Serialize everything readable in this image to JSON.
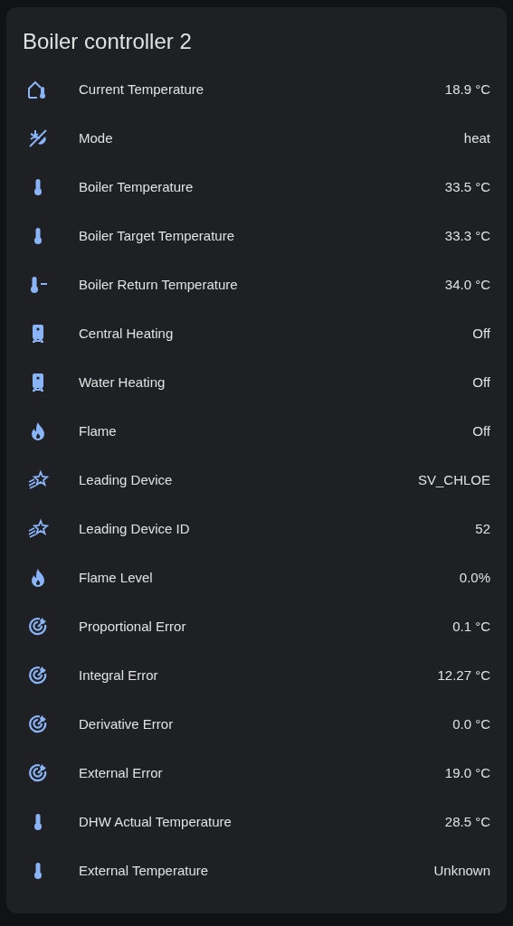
{
  "card": {
    "title": "Boiler controller 2",
    "rows": [
      {
        "kind": "house",
        "name": "Current Temperature",
        "value": "18.9 °C"
      },
      {
        "kind": "mode",
        "name": "Mode",
        "value": "heat"
      },
      {
        "kind": "thermometer",
        "name": "Boiler Temperature",
        "value": "33.5 °C"
      },
      {
        "kind": "thermometer",
        "name": "Boiler Target Temperature",
        "value": "33.3 °C"
      },
      {
        "kind": "return",
        "name": "Boiler Return Temperature",
        "value": "34.0 °C"
      },
      {
        "kind": "boiler",
        "name": "Central Heating",
        "value": "Off"
      },
      {
        "kind": "boiler",
        "name": "Water Heating",
        "value": "Off"
      },
      {
        "kind": "flame",
        "name": "Flame",
        "value": "Off"
      },
      {
        "kind": "star",
        "name": "Leading Device",
        "value": "SV_CHLOE"
      },
      {
        "kind": "star",
        "name": "Leading Device ID",
        "value": "52"
      },
      {
        "kind": "flame",
        "name": "Flame Level",
        "value": "0.0%"
      },
      {
        "kind": "target",
        "name": "Proportional Error",
        "value": "0.1 °C"
      },
      {
        "kind": "target",
        "name": "Integral Error",
        "value": "12.27 °C"
      },
      {
        "kind": "target",
        "name": "Derivative Error",
        "value": "0.0 °C"
      },
      {
        "kind": "target",
        "name": "External Error",
        "value": "19.0 °C"
      },
      {
        "kind": "thermometer",
        "name": "DHW Actual Temperature",
        "value": "28.5 °C"
      },
      {
        "kind": "thermometer",
        "name": "External Temperature",
        "value": "Unknown"
      }
    ]
  }
}
